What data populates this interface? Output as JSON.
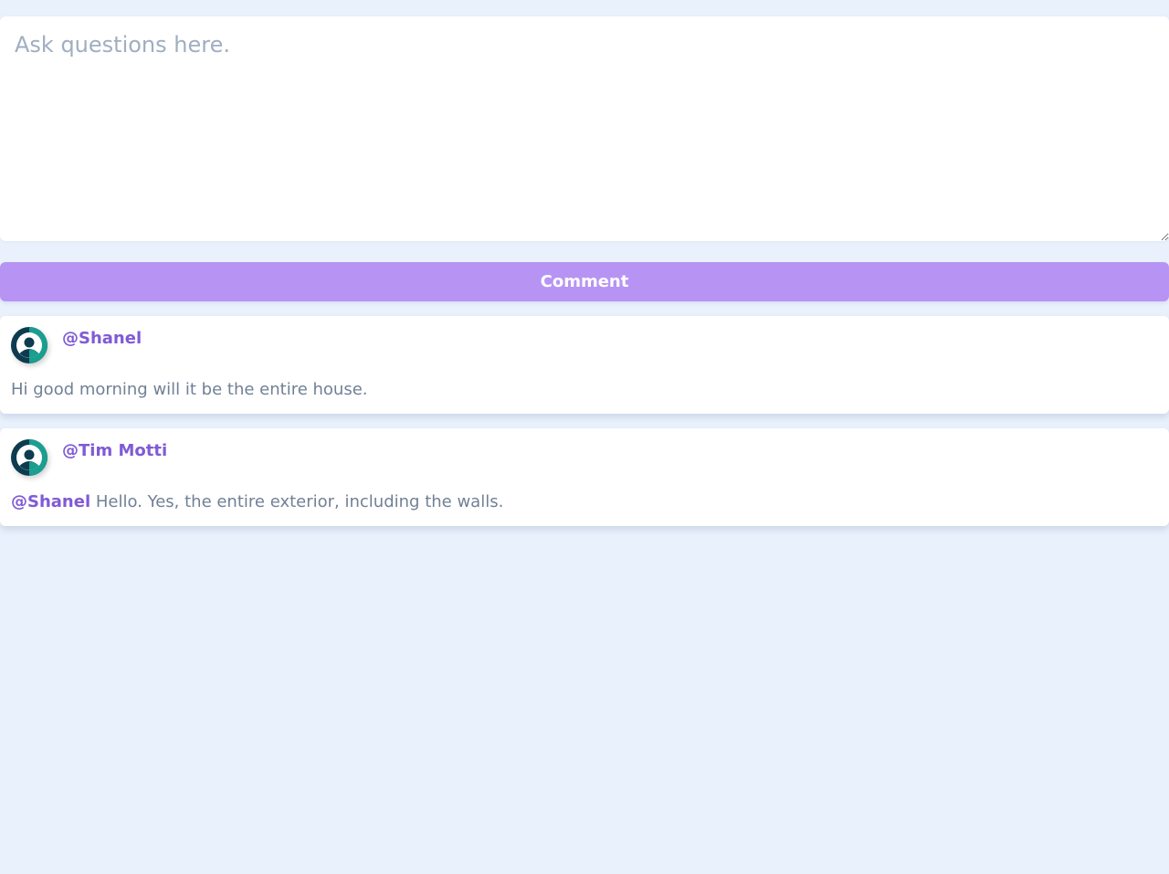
{
  "question_input": {
    "placeholder": "Ask questions here.",
    "value": ""
  },
  "comment_button": {
    "label": "Comment"
  },
  "comments": [
    {
      "author": "@Shanel",
      "mention": "",
      "text": "Hi good morning will it be the entire house."
    },
    {
      "author": "@Tim Motti",
      "mention": "@Shanel",
      "text": " Hello. Yes, the entire exterior, including the walls."
    }
  ],
  "icons": {
    "avatar": "user-avatar-icon"
  },
  "colors": {
    "background": "#e9f2fc",
    "button": "#b794f4",
    "username": "#805ad5",
    "body_text": "#718096",
    "avatar_dark": "#0d3b4f",
    "avatar_teal": "#1a9e8f"
  }
}
